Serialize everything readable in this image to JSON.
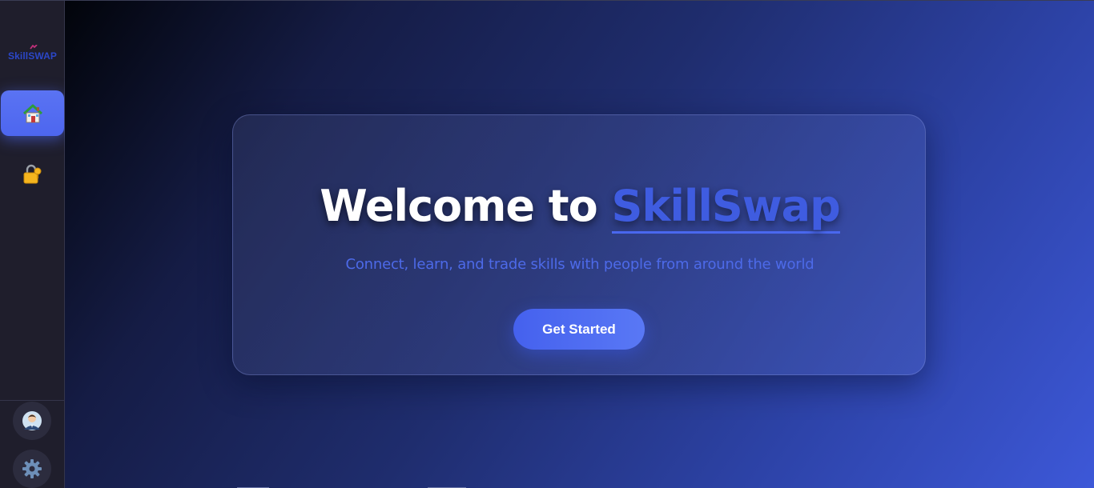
{
  "sidebar": {
    "logo_text": "SkillSWAP",
    "nav": [
      {
        "id": "home",
        "icon": "house-icon",
        "active": true
      },
      {
        "id": "lock",
        "icon": "lock-key-icon",
        "active": false
      }
    ],
    "profile_icon": "user-avatar-icon",
    "settings_icon": "gear-icon"
  },
  "hero": {
    "title_prefix": "Welcome to ",
    "title_brand": "SkillSwap",
    "subtitle": "Connect, learn, and trade skills with people from around the world",
    "cta_label": "Get Started"
  },
  "colors": {
    "accent": "#4d66ef",
    "brand_text": "#3f5ce0",
    "sidebar_bg": "#1f1e2c"
  }
}
